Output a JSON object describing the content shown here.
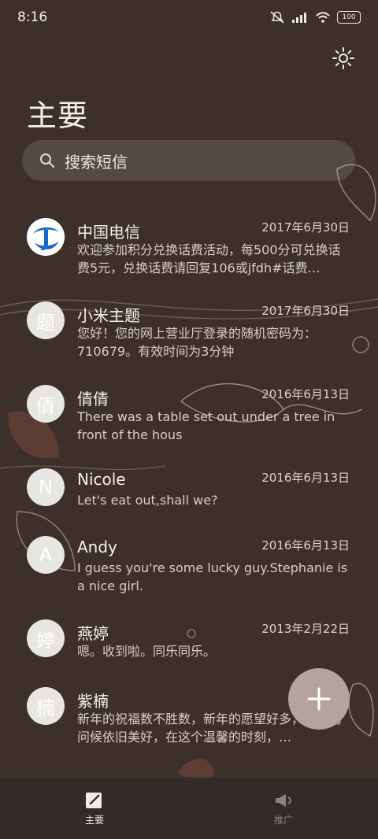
{
  "status": {
    "time": "8:16",
    "battery": "100"
  },
  "icons": {
    "settings": "gear-icon",
    "search": "search-icon",
    "fab": "plus-icon",
    "nav_home": "edit-icon",
    "nav_promo": "megaphone-icon"
  },
  "header": {
    "title": "主要"
  },
  "search": {
    "placeholder": "搜索短信"
  },
  "messages": [
    {
      "avatar": "",
      "name": "中国电信",
      "date": "2017年6月30日",
      "preview": "欢迎参加积分兑换话费活动，每500分可兑换话费5元，兑换话费请回复106或jfdh#话费…"
    },
    {
      "avatar": "题",
      "name": "小米主题",
      "date": "2017年6月30日",
      "preview": "您好！您的网上营业厅登录的随机密码为：710679。有效时间为3分钟"
    },
    {
      "avatar": "倩",
      "name": "倩倩",
      "date": "2016年6月13日",
      "preview": "There was a table set out under a tree in front of the hous"
    },
    {
      "avatar": "N",
      "name": "Nicole",
      "date": "2016年6月13日",
      "preview": "Let's eat out,shall we?"
    },
    {
      "avatar": "A",
      "name": "Andy",
      "date": "2016年6月13日",
      "preview": "I guess you're some lucky guy.Stephanie is a nice girl."
    },
    {
      "avatar": "婷",
      "name": "燕婷",
      "date": "2013年2月22日",
      "preview": "嗯。收到啦。同乐同乐。"
    },
    {
      "avatar": "楠",
      "name": "紫楠",
      "date": "2013",
      "preview": "新年的祝福数不胜数，新年的愿望好多，新年的问候依旧美好，在这个温馨的时刻，…"
    }
  ],
  "bottom_nav": {
    "home": "主要",
    "promo": "推广"
  },
  "colors": {
    "background": "#3d302a",
    "avatar_bg": "#e8e6e2",
    "telecom_blue": "#1867c9",
    "fab_bg": "#b4a49d"
  }
}
